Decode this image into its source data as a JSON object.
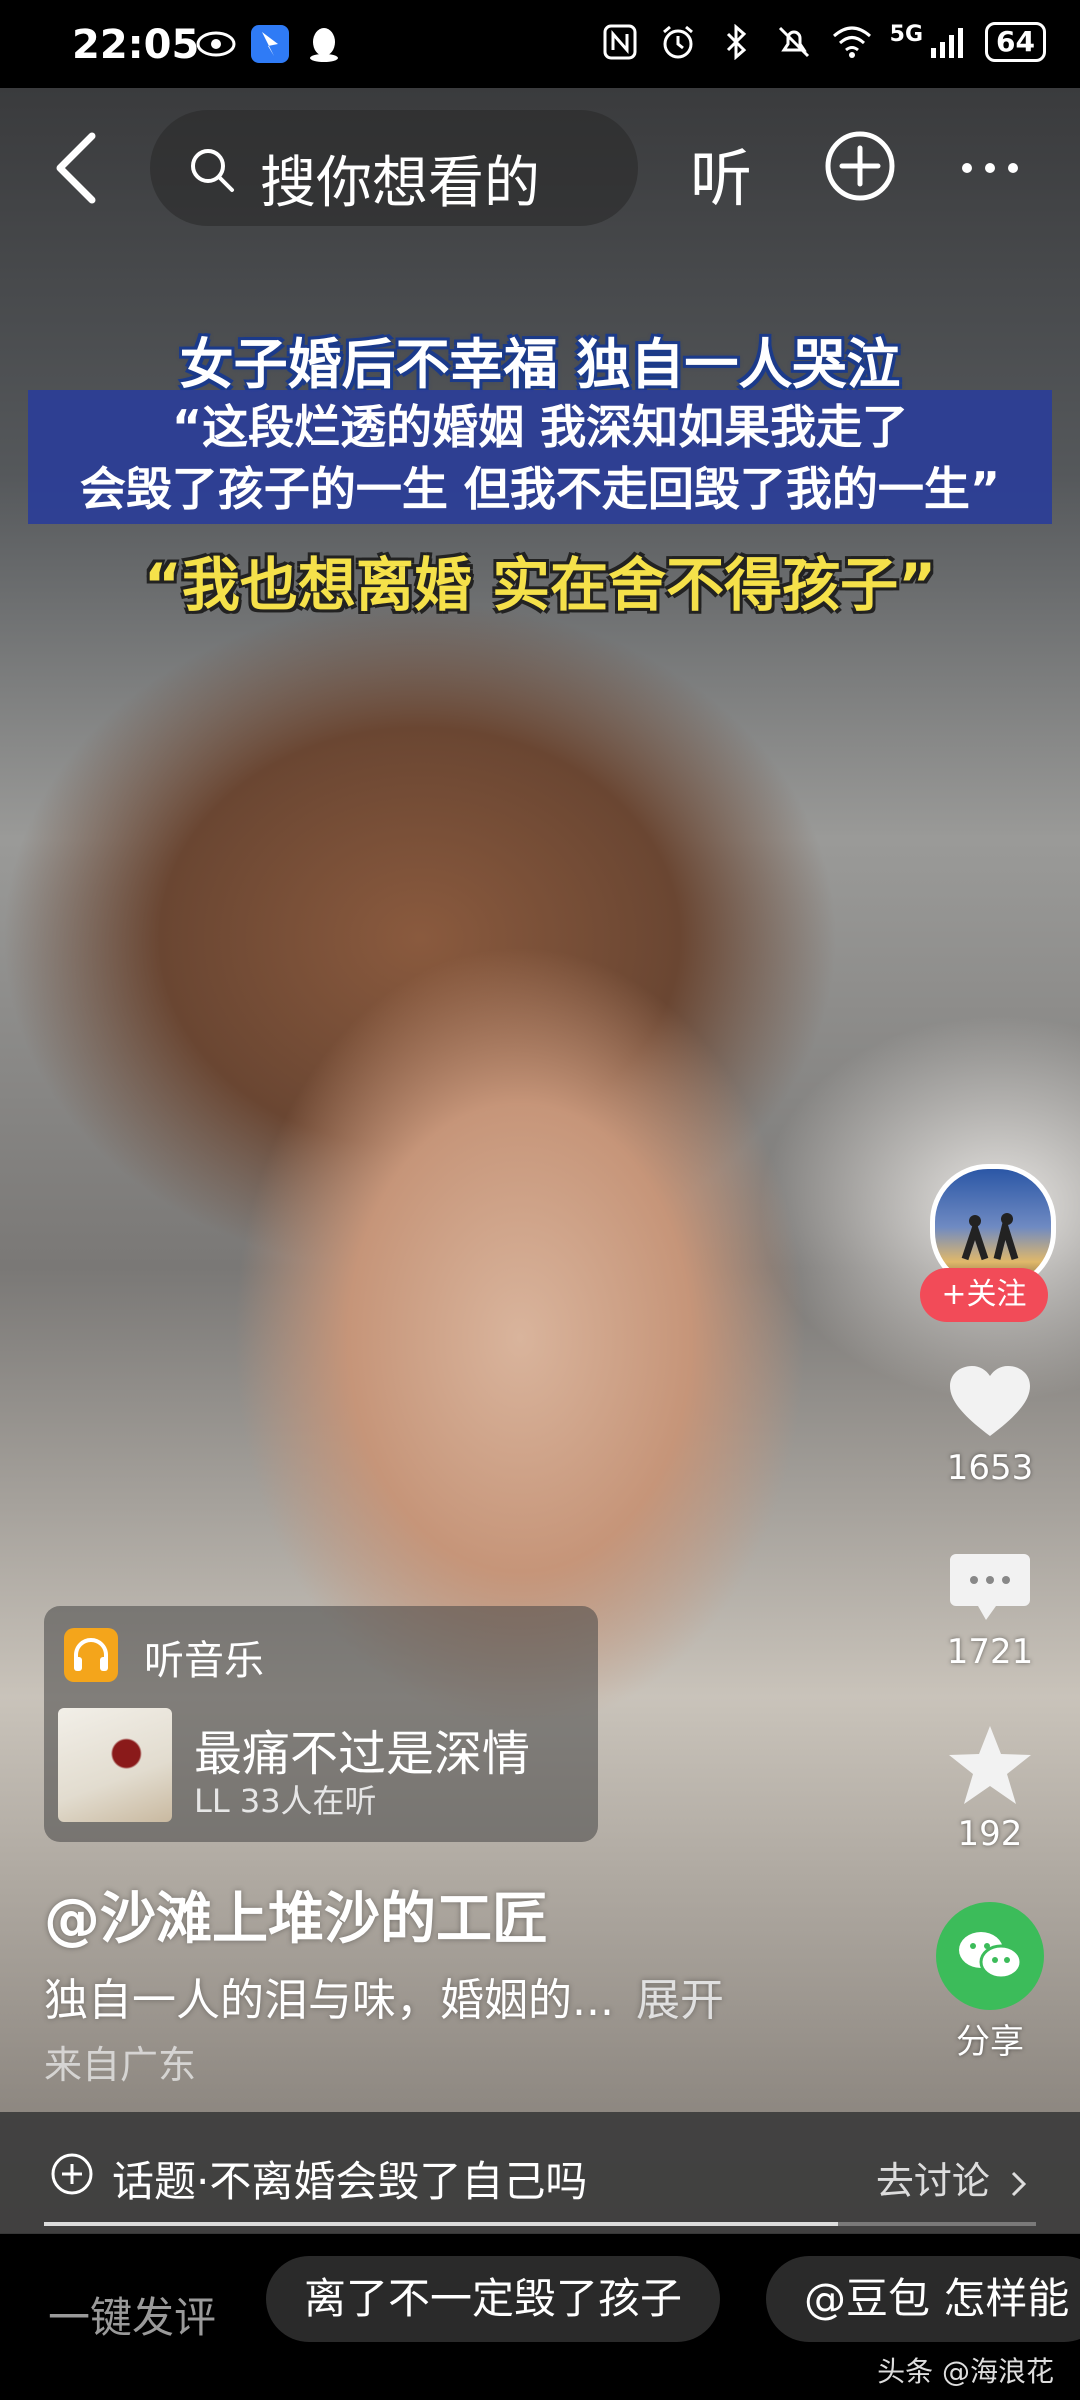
{
  "status_bar": {
    "time": "22:05",
    "network": "5G",
    "battery": "64"
  },
  "header": {
    "search_placeholder": "搜你想看的",
    "listen_label": "听"
  },
  "video": {
    "caption_title": "女子婚后不幸福 独自一人哭泣",
    "caption_quote_line1": "“这段烂透的婚姻 我深知如果我走了",
    "caption_quote_line2": "会毁了孩子的一生 但我不走回毁了我的一生”",
    "caption_highlight": "“我也想离婚 实在舍不得孩子”"
  },
  "right_rail": {
    "follow_label": "+关注",
    "likes": "1653",
    "comments": "1721",
    "favorites": "192",
    "share_label": "分享"
  },
  "music": {
    "header_label": "听音乐",
    "title": "最痛不过是深情",
    "subtitle": "LL 33人在听"
  },
  "post": {
    "author": "@沙滩上堆沙的工匠",
    "description": "独自一人的泪与味，婚姻的...",
    "expand_label": "展开",
    "location": "来自广东"
  },
  "topic": {
    "text": "话题·不离婚会毁了自己吗",
    "action": "去讨论",
    "progress": 0.8
  },
  "bottom": {
    "quick_label": "一键发评",
    "chips": [
      "离了不一定毁了孩子",
      "@豆包 怎样能"
    ],
    "watermark": "头条 @海浪花"
  },
  "colors": {
    "follow": "#f24b58",
    "share": "#3cbc5a",
    "music_icon": "#f4a51b",
    "caption_box": "#2c3e96",
    "caption_highlight": "#f5e14a"
  }
}
